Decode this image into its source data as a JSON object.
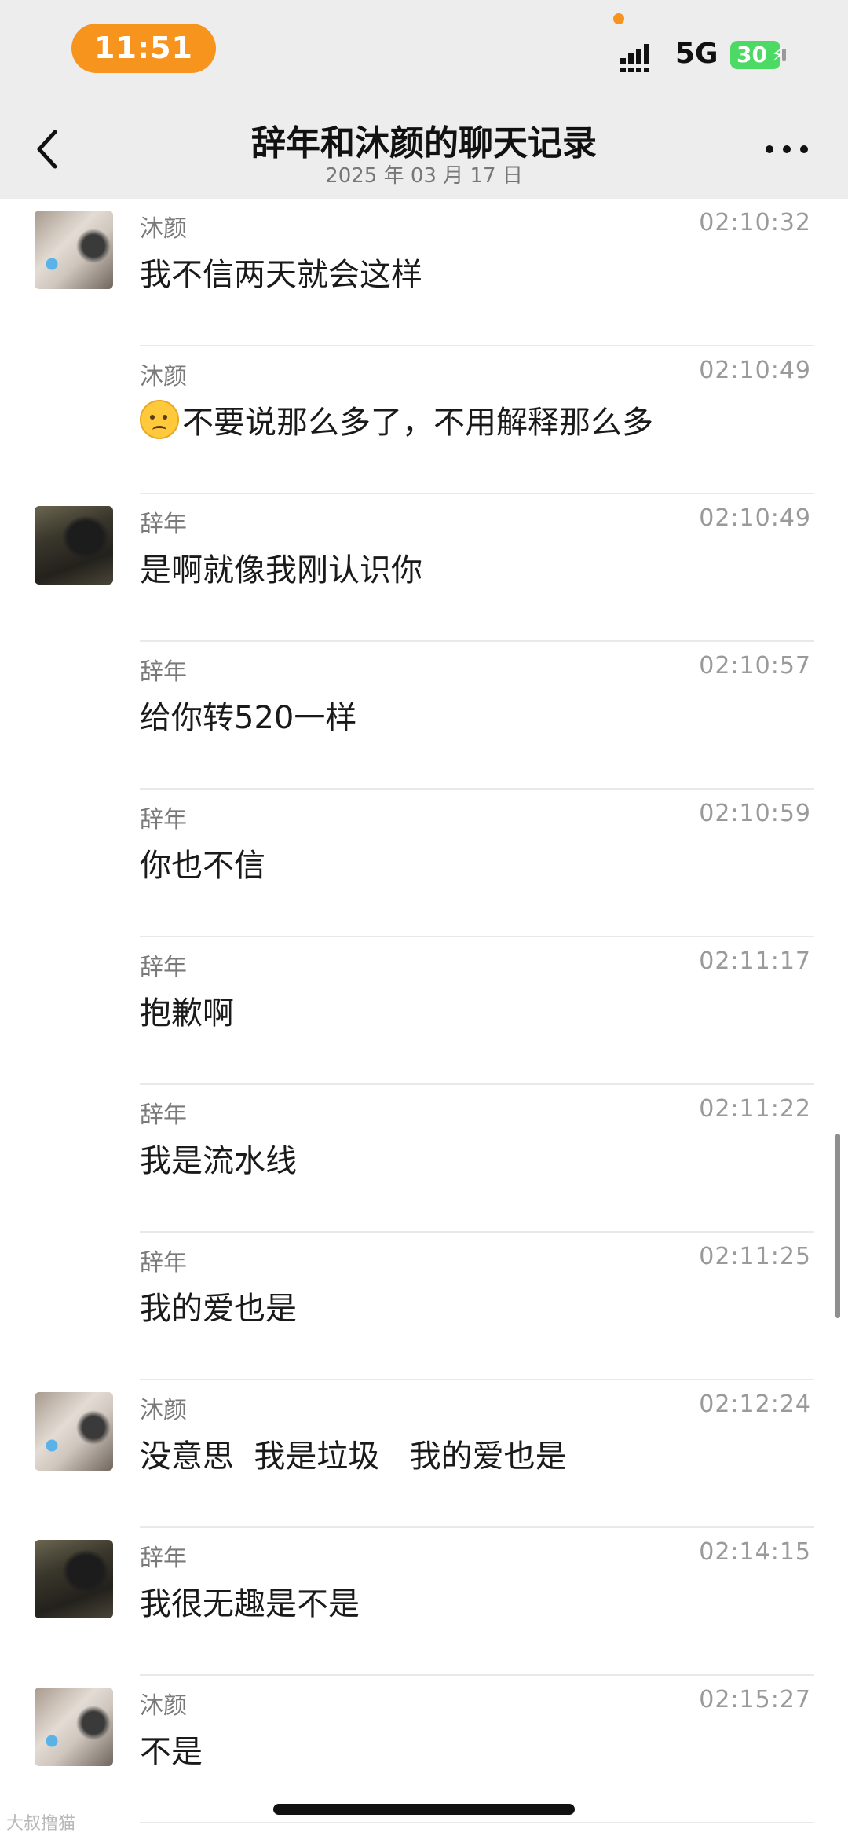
{
  "status_bar": {
    "time": "11:51",
    "network": "5G",
    "battery": "30",
    "colors": {
      "accent": "#f7941d",
      "battery": "#4cd964"
    }
  },
  "header": {
    "title": "辞年和沐颜的聊天记录",
    "date": "2025 年 03 月 17 日",
    "back_icon": "chevron-left-icon",
    "more_icon": "more-icon"
  },
  "messages": [
    {
      "sender": "沐颜",
      "time": "02:10:32",
      "text": "我不信两天就会这样",
      "avatar": "cat"
    },
    {
      "sender": "沐颜",
      "time": "02:10:49",
      "text": "不要说那么多了，不用解释那么多",
      "emoji": "frowning-face-emoji"
    },
    {
      "sender": "辞年",
      "time": "02:10:49",
      "text": "是啊就像我刚认识你",
      "avatar": "person"
    },
    {
      "sender": "辞年",
      "time": "02:10:57",
      "text": "给你转520一样"
    },
    {
      "sender": "辞年",
      "time": "02:10:59",
      "text": "你也不信"
    },
    {
      "sender": "辞年",
      "time": "02:11:17",
      "text": "抱歉啊"
    },
    {
      "sender": "辞年",
      "time": "02:11:22",
      "text": "我是流水线"
    },
    {
      "sender": "辞年",
      "time": "02:11:25",
      "text": "我的爱也是"
    },
    {
      "sender": "沐颜",
      "time": "02:12:24",
      "text": "没意思  我是垃圾   我的爱也是",
      "avatar": "cat"
    },
    {
      "sender": "辞年",
      "time": "02:14:15",
      "text": "我很无趣是不是",
      "avatar": "person"
    },
    {
      "sender": "沐颜",
      "time": "02:15:27",
      "text": "不是",
      "avatar": "cat"
    }
  ],
  "watermark": "大叔撸猫"
}
